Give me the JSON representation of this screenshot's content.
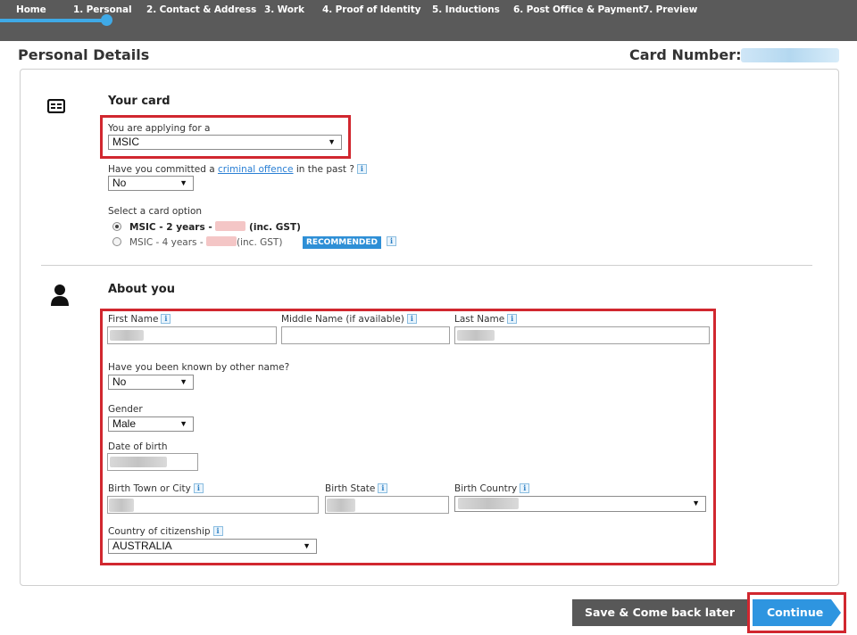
{
  "nav": {
    "tabs": [
      {
        "label": "Home"
      },
      {
        "label": "1. Personal"
      },
      {
        "label": "2. Contact & Address"
      },
      {
        "label": "3. Work"
      },
      {
        "label": "4. Proof of Identity"
      },
      {
        "label": "5. Inductions"
      },
      {
        "label": "6. Post Office & Payment"
      },
      {
        "label": "7. Preview"
      }
    ],
    "active_tab": "1. Personal",
    "accent_color": "#3fa9e6",
    "bar_color": "#5a5a5a"
  },
  "header": {
    "title": "Personal Details",
    "card_number_label": "Card Number:"
  },
  "your_card": {
    "title": "Your card",
    "icon": "id-card-icon",
    "applying_label": "You are applying for a",
    "applying_value": "MSIC",
    "criminal_prefix": "Have you committed a ",
    "criminal_link": "criminal offence",
    "criminal_suffix": " in the past ?",
    "criminal_value": "No",
    "card_option_label": "Select a card option",
    "options": [
      {
        "label_a": "MSIC - 2 years - ",
        "label_b": " (inc. GST)",
        "selected": true
      },
      {
        "label_a": "MSIC - 4 years - ",
        "label_b": "(inc. GST)",
        "selected": false
      }
    ],
    "recommended_badge": "RECOMMENDED"
  },
  "about_you": {
    "title": "About you",
    "icon": "person-icon",
    "first_name_label": "First Name",
    "middle_name_label": "Middle Name (if available)",
    "last_name_label": "Last Name",
    "other_name_label": "Have you been known by other name?",
    "other_name_value": "No",
    "gender_label": "Gender",
    "gender_value": "Male",
    "dob_label": "Date of birth",
    "birth_town_label": "Birth Town or City",
    "birth_state_label": "Birth State",
    "birth_country_label": "Birth Country",
    "citizenship_label": "Country of citizenship",
    "citizenship_value": "AUSTRALIA"
  },
  "info_icon_glyph": "i",
  "select_arrow": "▼",
  "buttons": {
    "save_label": "Save & Come back later",
    "continue_label": "Continue"
  },
  "colors": {
    "highlight": "#d1272f",
    "primary_button": "#2e95e0",
    "secondary_button": "#585858"
  }
}
